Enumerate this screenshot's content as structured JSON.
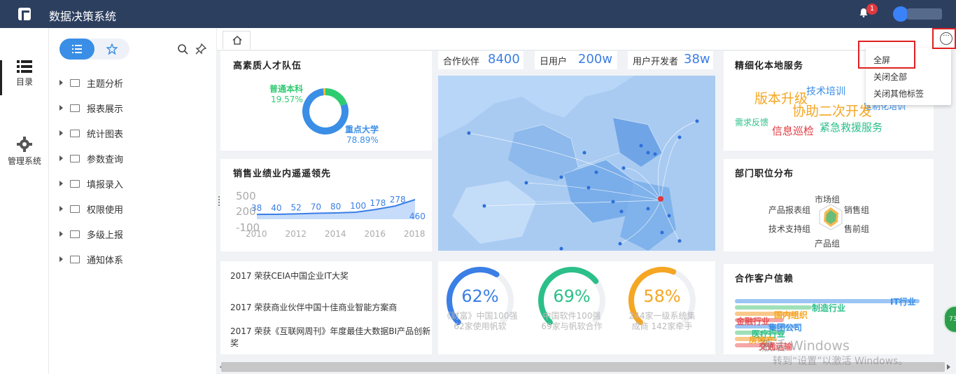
{
  "app": {
    "title": "数据决策系统",
    "notification_count": "1"
  },
  "leftnav": {
    "items": [
      {
        "label": "目录"
      },
      {
        "label": "管理系统"
      }
    ]
  },
  "sidebar": {
    "tree": [
      {
        "label": "主题分析"
      },
      {
        "label": "报表展示"
      },
      {
        "label": "统计图表"
      },
      {
        "label": "参数查询"
      },
      {
        "label": "填报录入"
      },
      {
        "label": "权限使用"
      },
      {
        "label": "多级上报"
      },
      {
        "label": "通知体系"
      }
    ]
  },
  "menu": {
    "items": [
      "全屏",
      "关闭全部",
      "关闭其他标签"
    ]
  },
  "stats": [
    {
      "label": "合作伙伴",
      "value": "8400"
    },
    {
      "label": "日用户",
      "value": "200w"
    },
    {
      "label": "用户开发者",
      "value": "38w"
    }
  ],
  "talent": {
    "title": "高素质人才队伍",
    "slices": [
      {
        "name": "普通本科",
        "percent": "19.57%",
        "value": 19.57,
        "color": "#2ecc71"
      },
      {
        "name": "重点大学",
        "percent": "78.89%",
        "value": 78.89,
        "color": "#3a8ee6"
      },
      {
        "name": "",
        "percent": "",
        "value": 1.54,
        "color": "#f0c030"
      }
    ]
  },
  "sales": {
    "title": "销售业绩业内遥遥领先",
    "y_ticks": [
      "500",
      "200",
      "-100"
    ],
    "x_ticks": [
      "2010",
      "2012",
      "2014",
      "2016",
      "2018"
    ],
    "chart_data": {
      "type": "area",
      "x": [
        "2010",
        "2011",
        "2012",
        "2013",
        "2014",
        "2015",
        "2016",
        "2017",
        "2018"
      ],
      "values": [
        38,
        40,
        52,
        70,
        80,
        100,
        178,
        278,
        460
      ],
      "labels": [
        "38",
        "40",
        "52",
        "70",
        "80",
        "100",
        "178",
        "278",
        "460"
      ],
      "ylim": [
        -100,
        500
      ]
    }
  },
  "awards": {
    "items": [
      "2017 荣获CEIA中国企业IT大奖",
      "2017 荣获商业伙伴中国十佳商业智能方案商",
      "2017 荣获《互联网周刊》年度最佳大数据BI产品创新奖"
    ]
  },
  "gauges": [
    {
      "value": "62%",
      "fraction": 0.62,
      "color": "#3a7ee6",
      "line1": "《财富》中国100强",
      "line2": "62家使用帆软"
    },
    {
      "value": "69%",
      "fraction": 0.69,
      "color": "#2bbf8a",
      "line1": "中国软件100强",
      "line2": "69家与帆软合作"
    },
    {
      "value": "58%",
      "fraction": 0.58,
      "color": "#f5a623",
      "line1": "244家一级系统集",
      "line2": "成商 142家牵手"
    }
  ],
  "service": {
    "title": "精细化本地服务",
    "words": [
      {
        "text": "版本升级",
        "color": "#f5a623"
      },
      {
        "text": "技术培训",
        "color": "#3a8ee6"
      },
      {
        "text": "定制化培训",
        "color": "#3a8ee6"
      },
      {
        "text": "协助二次开发",
        "color": "#f5a623"
      },
      {
        "text": "需求反馈",
        "color": "#2bbf8a"
      },
      {
        "text": "信息巡检",
        "color": "#e0383e"
      },
      {
        "text": "紧急救援服务",
        "color": "#2bbf8a"
      }
    ]
  },
  "dept": {
    "title": "部门职位分布",
    "labels": [
      "市场组",
      "销售组",
      "售前组",
      "产品组",
      "技术支持组",
      "产品报表组"
    ]
  },
  "clients": {
    "title": "合作客户信赖",
    "labels": [
      {
        "text": "IT行业",
        "color": "#3a8ee6"
      },
      {
        "text": "制造行业",
        "color": "#2bbf8a"
      },
      {
        "text": "国内组织",
        "color": "#f5a623"
      },
      {
        "text": "金融行业",
        "color": "#e0383e"
      },
      {
        "text": "集团公司",
        "color": "#3a8ee6"
      },
      {
        "text": "医疗行业",
        "color": "#2bbf8a"
      },
      {
        "text": "房地产",
        "color": "#f5a623"
      },
      {
        "text": "交通运输",
        "color": "#e0383e"
      }
    ]
  },
  "windows": {
    "line1": "激活 Windows",
    "line2": "转到“设置”以激活 Windows。"
  },
  "floating": {
    "text": "73"
  }
}
